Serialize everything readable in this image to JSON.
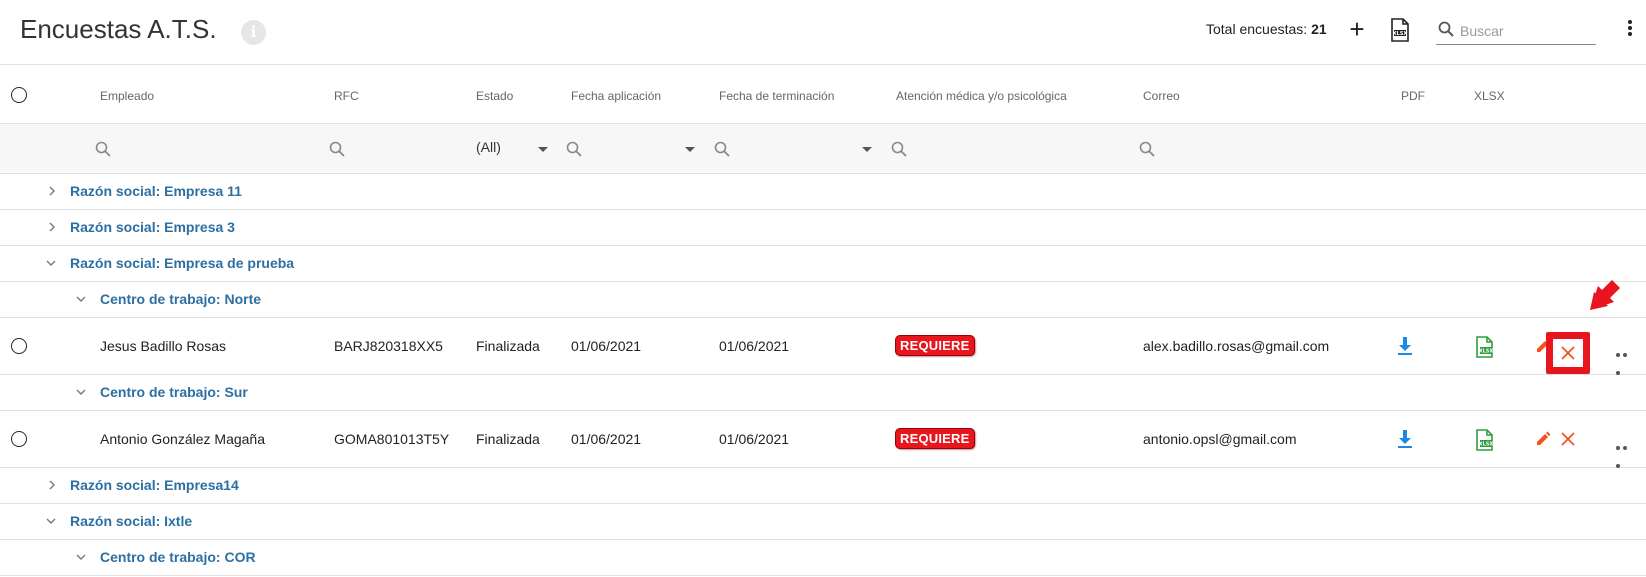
{
  "header": {
    "title": "Encuestas A.T.S.",
    "info_icon": "i",
    "total_label": "Total encuestas:",
    "total_count": "21",
    "add_label": "+",
    "search_placeholder": "Buscar"
  },
  "columns": {
    "empleado": "Empleado",
    "rfc": "RFC",
    "estado": "Estado",
    "fecha_aplicacion": "Fecha aplicación",
    "fecha_terminacion": "Fecha de terminación",
    "atencion": "Atención médica y/o psicológica",
    "correo": "Correo",
    "pdf": "PDF",
    "xlsx": "XLSX"
  },
  "filters": {
    "estado_value": "(All)"
  },
  "groups": {
    "g1": "Razón social: Empresa 11",
    "g2": "Razón social: Empresa 3",
    "g3": "Razón social: Empresa de prueba",
    "g3_sub1": "Centro de trabajo: Norte",
    "g3_sub2": "Centro de trabajo: Sur",
    "g4": "Razón social: Empresa14",
    "g5": "Razón social: Ixtle",
    "g5_sub1": "Centro de trabajo: COR"
  },
  "rows": [
    {
      "empleado": "Jesus Badillo Rosas",
      "rfc": "BARJ820318XX5",
      "estado": "Finalizada",
      "fecha_aplicacion": "01/06/2021",
      "fecha_terminacion": "01/06/2021",
      "atencion": "REQUIERE",
      "correo": "alex.badillo.rosas@gmail.com"
    },
    {
      "empleado": "Antonio González Magaña",
      "rfc": "GOMA801013T5Y",
      "estado": "Finalizada",
      "fecha_aplicacion": "01/06/2021",
      "fecha_terminacion": "01/06/2021",
      "atencion": "REQUIERE",
      "correo": "antonio.opsl@gmail.com"
    }
  ],
  "colors": {
    "group_label": "#2c6fa3",
    "badge": "#e8141e",
    "download_icon": "#1e88e5",
    "xlsx_icon": "#2e9e3e",
    "edit_icon": "#f4511e",
    "delete_icon": "#f4511e",
    "highlight": "#e8141e"
  },
  "icons": [
    "info-icon",
    "plus-icon",
    "xlsx-file-icon",
    "search-icon",
    "kebab-icon",
    "chevron-right-icon",
    "chevron-down-icon",
    "download-icon",
    "pencil-icon",
    "close-icon",
    "more-horizontal-icon",
    "red-arrow-annotation"
  ]
}
